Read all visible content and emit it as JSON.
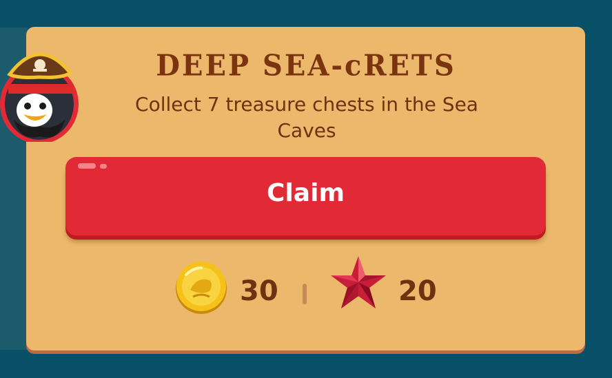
{
  "challenge": {
    "title": "DEEP SEA-cRETS",
    "description": "Collect 7 treasure chests in the Sea Caves"
  },
  "claim_button": {
    "label": "Claim"
  },
  "rewards": {
    "coins": "30",
    "gems": "20"
  },
  "icons": {
    "avatar": "pirate-penguin-avatar-icon",
    "coin": "gold-coin-icon",
    "gem": "red-star-gem-icon"
  },
  "colors": {
    "background": "#075068",
    "card": "#ecb86c",
    "button": "#e12a35",
    "text": "#6b330f"
  }
}
